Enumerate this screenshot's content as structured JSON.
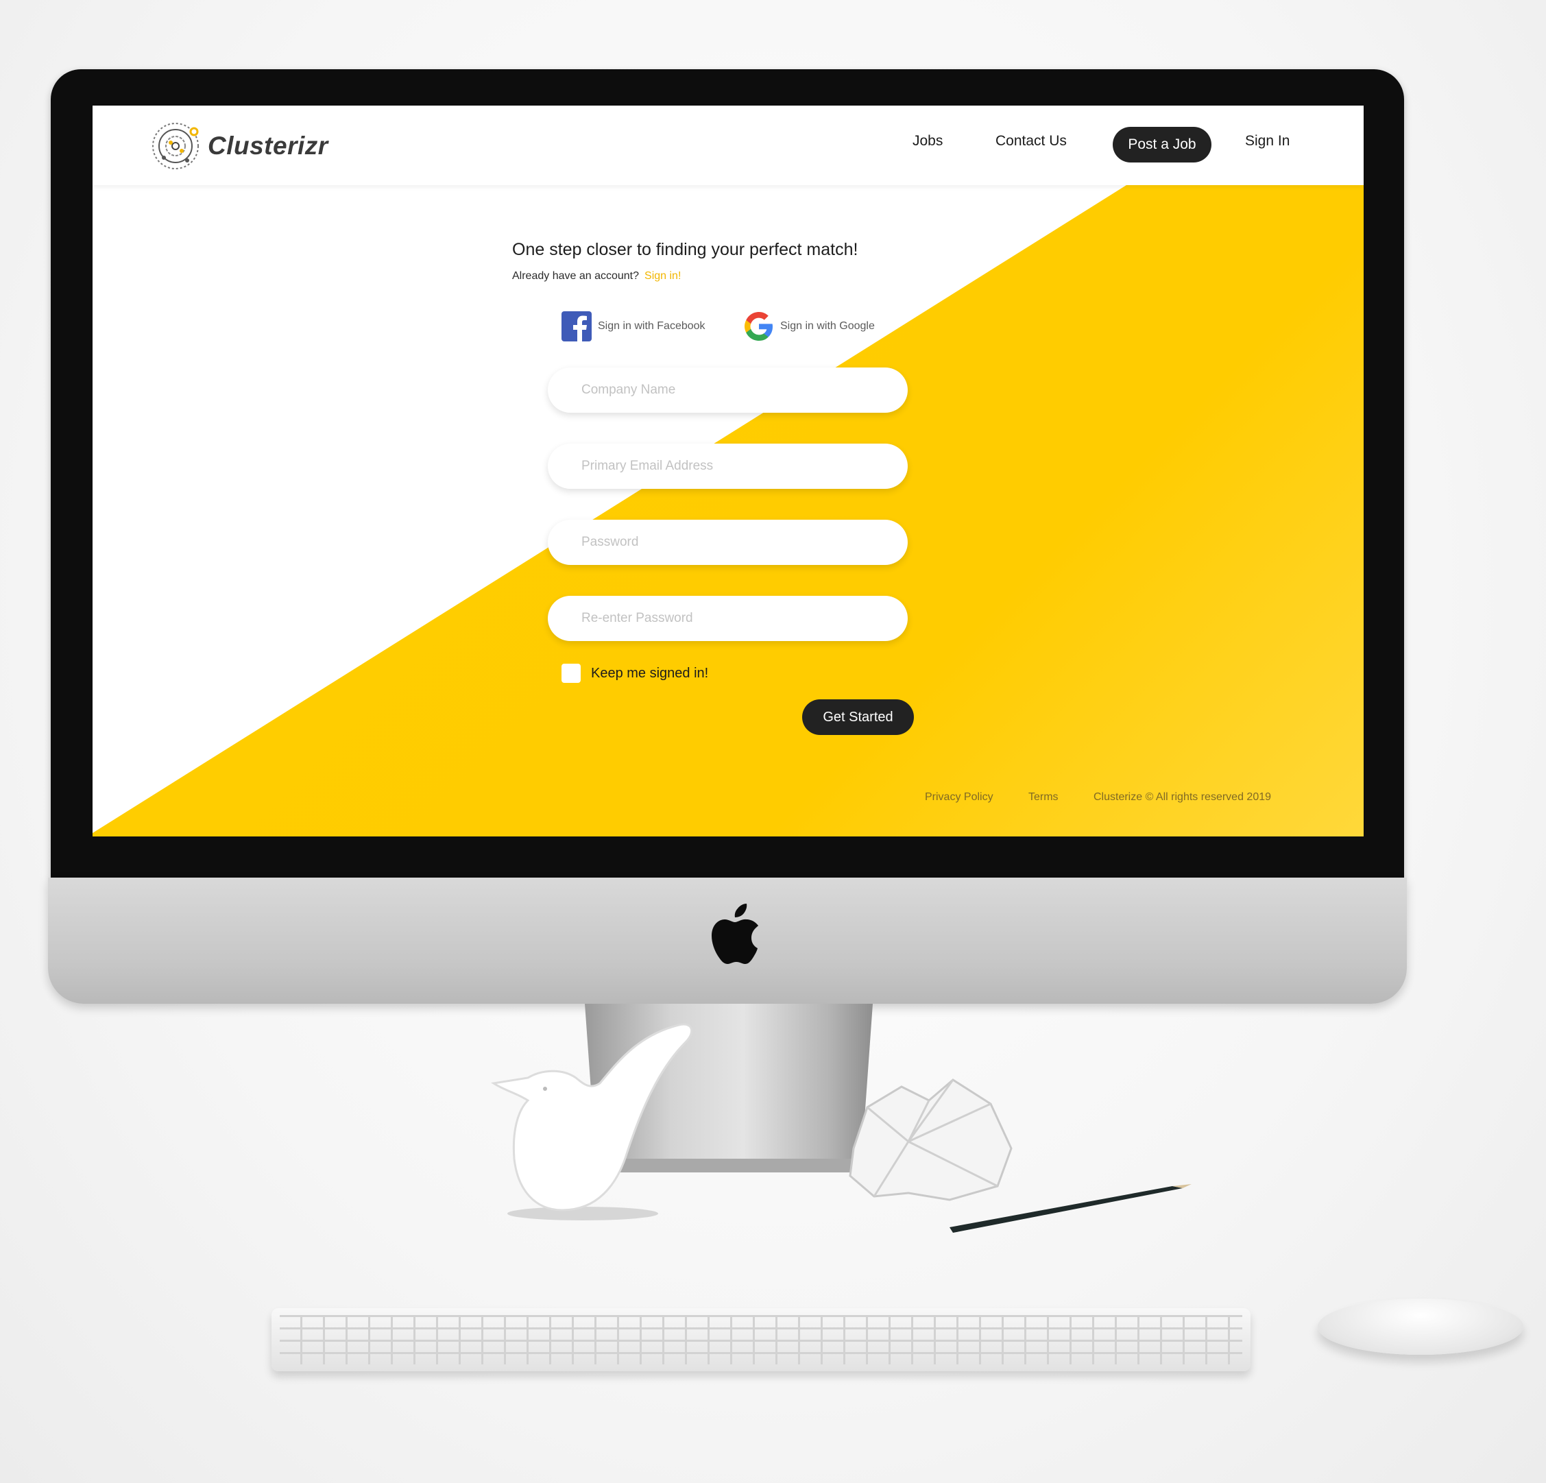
{
  "brand": {
    "name": "Clusterizr"
  },
  "nav": {
    "jobs": "Jobs",
    "contact": "Contact Us",
    "post_job": "Post a Job",
    "sign_in": "Sign In"
  },
  "signup": {
    "headline": "One step closer to finding your perfect match!",
    "have_account": "Already have an account?",
    "sign_in_link": "Sign in!",
    "facebook_label": "Sign in with Facebook",
    "google_label": "Sign in with Google",
    "fields": {
      "company_name": "Company Name",
      "email": "Primary Email Address",
      "password": "Password",
      "reenter_password": "Re-enter Password"
    },
    "keep_signed_in": "Keep me signed in!",
    "submit": "Get Started"
  },
  "footer": {
    "privacy": "Privacy Policy",
    "terms": "Terms",
    "copyright": "Clusterize © All rights reserved 2019"
  },
  "colors": {
    "accent_yellow": "#ffcc00",
    "dark_button": "#222222",
    "link_yellow": "#f2b600"
  },
  "icons": [
    "facebook-icon",
    "google-icon",
    "apple-logo-icon",
    "clusterizr-logo-icon"
  ]
}
